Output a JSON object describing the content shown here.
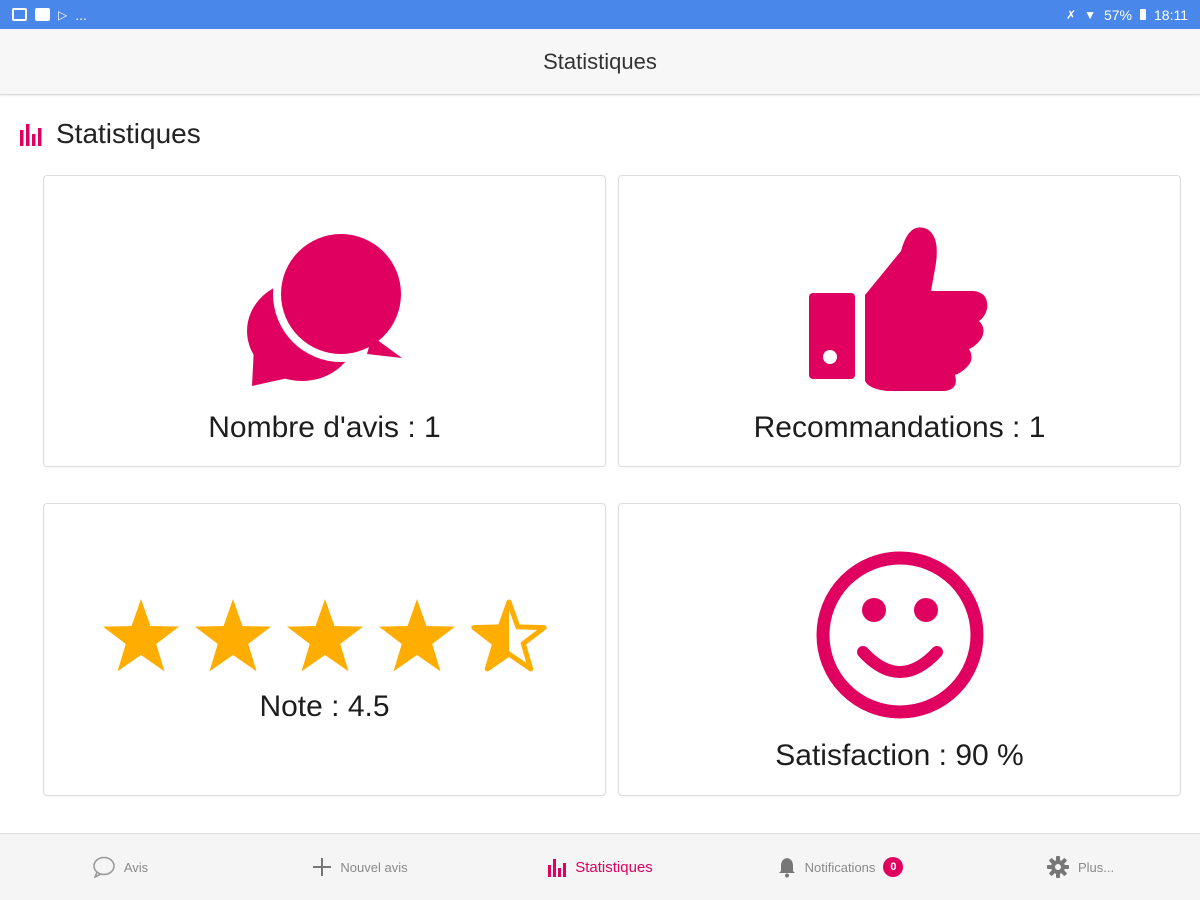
{
  "status_bar": {
    "left_icons": [
      "image-icon",
      "note-icon",
      "play-icon"
    ],
    "left_more": "...",
    "battery": "57%",
    "time": "18:11"
  },
  "app_bar": {
    "title": "Statistiques"
  },
  "section": {
    "title": "Statistiques",
    "icon": "bar-chart-icon"
  },
  "cards": {
    "reviews": {
      "label": "Nombre d'avis : 1",
      "icon": "chat-bubbles-icon"
    },
    "recommendations": {
      "label": "Recommandations : 1",
      "icon": "thumbs-up-icon"
    },
    "rating": {
      "label": "Note : 4.5",
      "stars_value": 4.5,
      "stars_max": 5,
      "icon": "star-icon"
    },
    "satisfaction": {
      "label": "Satisfaction : 90 %",
      "icon": "smiley-icon"
    }
  },
  "bottom_nav": {
    "items": [
      {
        "label": "Avis",
        "icon": "chat-icon",
        "active": false
      },
      {
        "label": "Nouvel avis",
        "icon": "plus-icon",
        "active": false
      },
      {
        "label": "Statistiques",
        "icon": "bar-chart-icon",
        "active": true
      },
      {
        "label": "Notifications",
        "icon": "bell-icon",
        "active": false,
        "badge": "0"
      },
      {
        "label": "Plus...",
        "icon": "gear-icon",
        "active": false
      }
    ]
  },
  "colors": {
    "accent": "#e0005f",
    "star": "#ffad00",
    "status_bar": "#4a87ea"
  }
}
